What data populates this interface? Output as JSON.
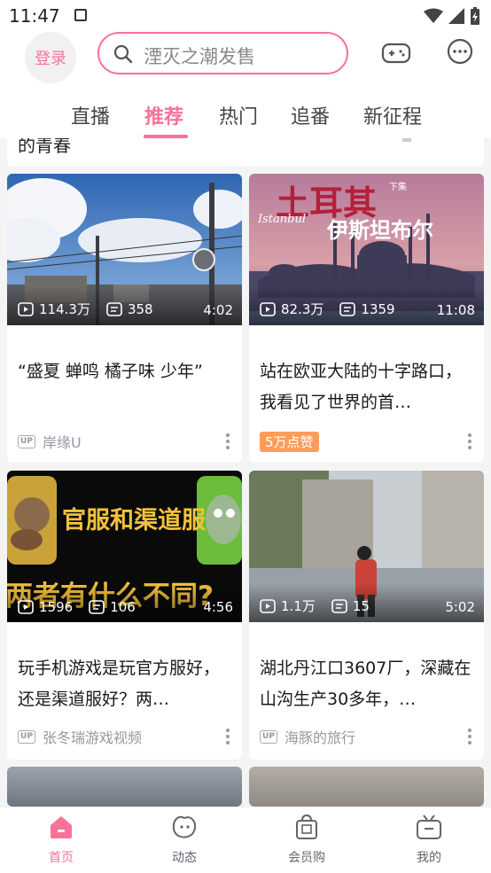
{
  "status_bar": {
    "time": "11:47"
  },
  "header": {
    "login_label": "登录",
    "search_placeholder": "湮灭之潮发售",
    "tabs": [
      "直播",
      "推荐",
      "热门",
      "追番",
      "新征程"
    ],
    "active_tab": "推荐"
  },
  "feed": {
    "previous_title_fragment": "的青春",
    "cards": [
      {
        "views": "114.3万",
        "danmaku": "358",
        "duration": "4:02",
        "title": "“盛夏 蝉鸣 橘子味 少年”",
        "author": "岸缘U"
      },
      {
        "views": "82.3万",
        "danmaku": "1359",
        "duration": "11:08",
        "title": "站在欧亚大陆的十字路口，我看见了世界的首…",
        "badge": "5万点赞",
        "thumb_text_main": "土耳其",
        "thumb_text_sub": "伊斯坦布尔",
        "thumb_text_small": "下集",
        "thumb_text_script": "Istanbul"
      },
      {
        "views": "1596",
        "danmaku": "106",
        "duration": "4:56",
        "title": "玩手机游戏是玩官方服好，还是渠道服好？两…",
        "author": "张冬瑞游戏视频",
        "thumb_text_top": "官服和渠道服",
        "thumb_text_bottom": "两者有什么不同?"
      },
      {
        "views": "1.1万",
        "danmaku": "15",
        "duration": "5:02",
        "title": "湖北丹江口3607厂，深藏在山沟生产30多年，…",
        "author": "海豚的旅行"
      }
    ]
  },
  "bottom_nav": [
    {
      "label": "首页",
      "icon": "home-icon",
      "active": true
    },
    {
      "label": "动态",
      "icon": "dynamic-icon",
      "active": false
    },
    {
      "label": "会员购",
      "icon": "shopping-bag-icon",
      "active": false
    },
    {
      "label": "我的",
      "icon": "tv-icon",
      "active": false
    }
  ],
  "colors": {
    "accent": "#fb7299",
    "badge": "#ff9c5a"
  }
}
